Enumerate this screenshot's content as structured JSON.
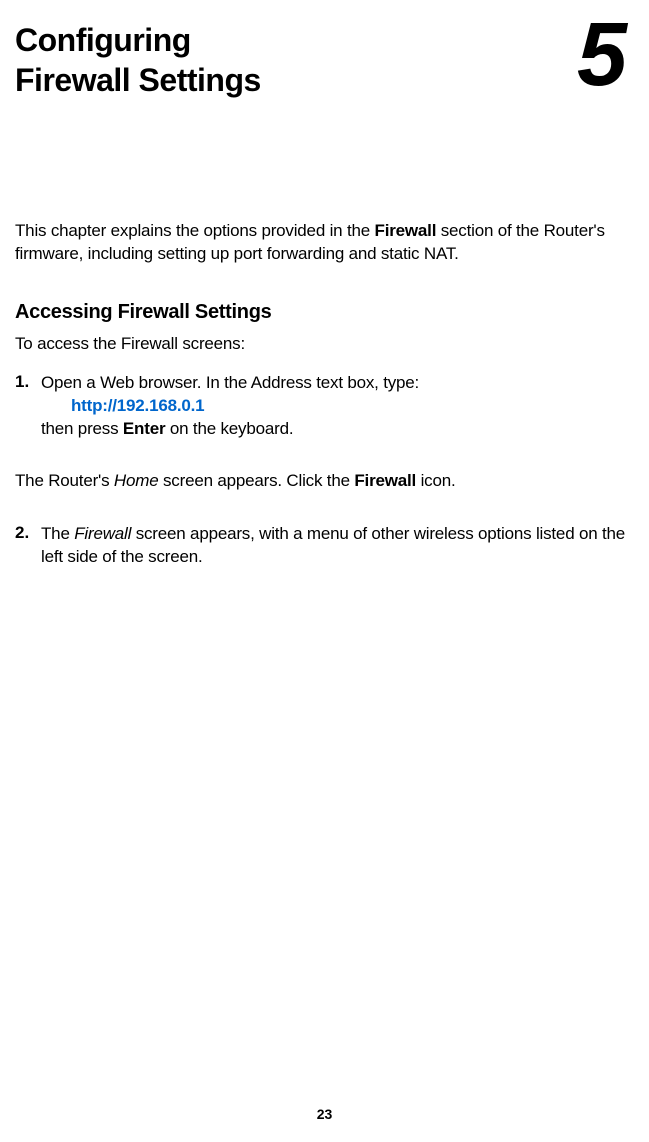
{
  "chapter": {
    "title_line1": "Configuring",
    "title_line2": "Firewall Settings",
    "number": "5"
  },
  "intro": {
    "text_before_bold": "This chapter explains the options provided in the ",
    "bold_word": "Firewall",
    "text_after_bold": " section of the Router's firmware, including setting up port forwarding and static NAT."
  },
  "section": {
    "heading": "Accessing Firewall Settings",
    "intro": "To access the Firewall screens:"
  },
  "step1": {
    "number": "1.",
    "text_before": "Open a Web browser. In the Address text box, type:",
    "url": "http://192.168.0.1",
    "text_after_before_bold": "then press ",
    "bold_word": "Enter",
    "text_after_after_bold": " on the keyboard."
  },
  "mid_paragraph": {
    "text_before_italic": "The Router's ",
    "italic_word": "Home",
    "text_middle": " screen appears. Click the ",
    "bold_word": "Firewall",
    "text_after": " icon."
  },
  "step2": {
    "number": "2.",
    "text_before_italic": "The ",
    "italic_word": "Firewall",
    "text_after": " screen appears, with a menu of other wireless options listed on the left side of the screen."
  },
  "page_number": "23"
}
